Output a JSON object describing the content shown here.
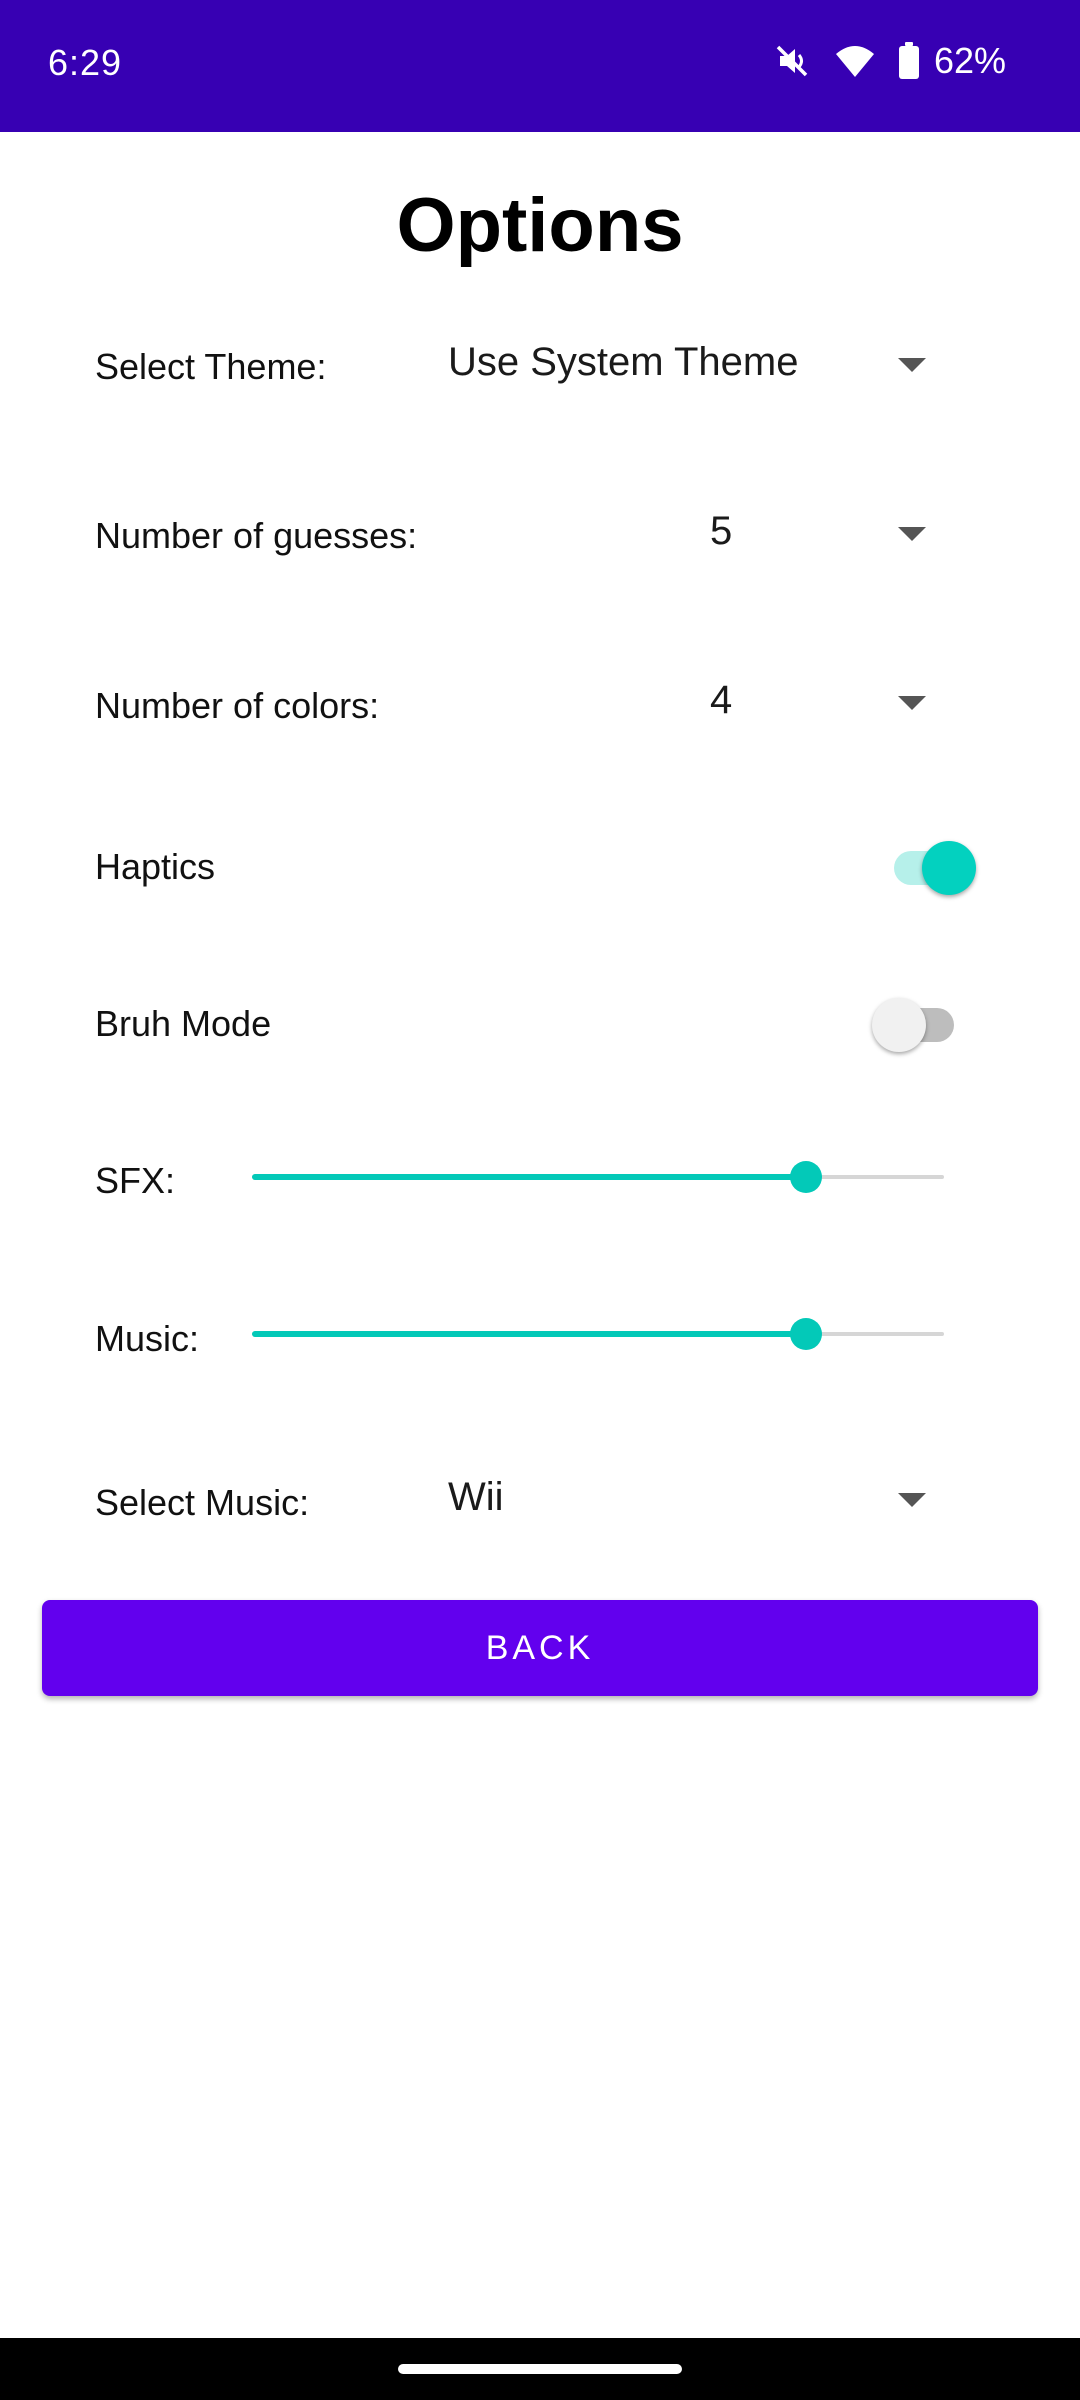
{
  "status_bar": {
    "time": "6:29",
    "battery_percent": "62%",
    "icons": [
      "mute-vibrate-off-icon",
      "wifi-icon",
      "battery-icon"
    ],
    "background": "#3700b3"
  },
  "page": {
    "title": "Options"
  },
  "settings": {
    "theme": {
      "label": "Select Theme:",
      "value": "Use System Theme"
    },
    "guesses": {
      "label": "Number of guesses:",
      "value": "5"
    },
    "colors": {
      "label": "Number of colors:",
      "value": "4"
    },
    "haptics": {
      "label": "Haptics",
      "enabled": true
    },
    "bruh_mode": {
      "label": "Bruh Mode",
      "enabled": false
    },
    "sfx": {
      "label": "SFX:",
      "level": 0.8
    },
    "music_volume": {
      "label": "Music:",
      "level": 0.8
    },
    "music_select": {
      "label": "Select Music:",
      "value": "Wii"
    }
  },
  "back_button": {
    "label": "BACK",
    "color": "#6200ee"
  },
  "accent_color": "#03c9b8"
}
